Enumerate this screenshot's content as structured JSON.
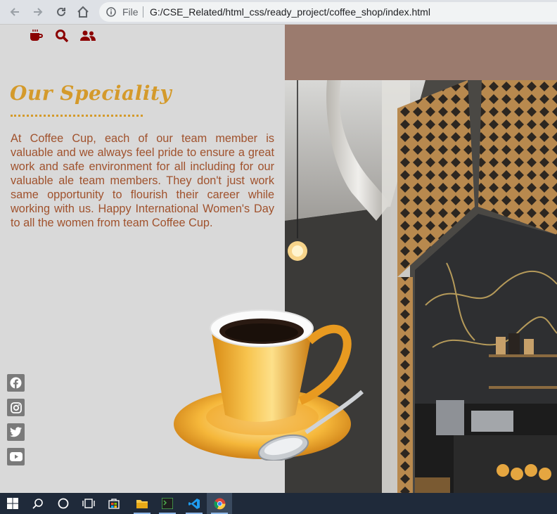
{
  "browser": {
    "file_label": "File",
    "url": "G:/CSE_Related/html_css/ready_project/coffee_shop/index.html"
  },
  "nav": {
    "icons": [
      "coffee-icon",
      "search-icon",
      "users-icon"
    ],
    "accent_color": "#8b0000"
  },
  "main": {
    "title": "Our Speciality",
    "paragraph": "At Coffee Cup, each of our team member is valuable and we always feel pride to ensure a great work and safe environment for all including for our valuable ale team members. They don't just work same opportunity to flourish their career while working with us. Happy International Women's Day to all the women from team Coffee Cup.",
    "title_color": "#d49a2b",
    "text_color": "#a0522d"
  },
  "social": [
    "facebook-icon",
    "instagram-icon",
    "twitter-icon",
    "youtube-icon"
  ],
  "taskbar": {
    "items": [
      "windows-start-icon",
      "search-icon",
      "cortana-icon",
      "task-view-icon",
      "store-icon",
      "file-explorer-icon",
      "terminal-icon",
      "vscode-icon",
      "chrome-icon"
    ]
  }
}
